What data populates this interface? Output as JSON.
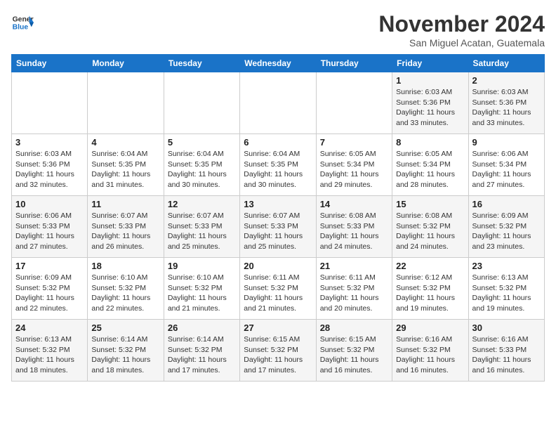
{
  "header": {
    "logo_line1": "General",
    "logo_line2": "Blue",
    "month": "November 2024",
    "location": "San Miguel Acatan, Guatemala"
  },
  "weekdays": [
    "Sunday",
    "Monday",
    "Tuesday",
    "Wednesday",
    "Thursday",
    "Friday",
    "Saturday"
  ],
  "weeks": [
    [
      {
        "day": "",
        "info": ""
      },
      {
        "day": "",
        "info": ""
      },
      {
        "day": "",
        "info": ""
      },
      {
        "day": "",
        "info": ""
      },
      {
        "day": "",
        "info": ""
      },
      {
        "day": "1",
        "info": "Sunrise: 6:03 AM\nSunset: 5:36 PM\nDaylight: 11 hours and 33 minutes."
      },
      {
        "day": "2",
        "info": "Sunrise: 6:03 AM\nSunset: 5:36 PM\nDaylight: 11 hours and 33 minutes."
      }
    ],
    [
      {
        "day": "3",
        "info": "Sunrise: 6:03 AM\nSunset: 5:36 PM\nDaylight: 11 hours and 32 minutes."
      },
      {
        "day": "4",
        "info": "Sunrise: 6:04 AM\nSunset: 5:35 PM\nDaylight: 11 hours and 31 minutes."
      },
      {
        "day": "5",
        "info": "Sunrise: 6:04 AM\nSunset: 5:35 PM\nDaylight: 11 hours and 30 minutes."
      },
      {
        "day": "6",
        "info": "Sunrise: 6:04 AM\nSunset: 5:35 PM\nDaylight: 11 hours and 30 minutes."
      },
      {
        "day": "7",
        "info": "Sunrise: 6:05 AM\nSunset: 5:34 PM\nDaylight: 11 hours and 29 minutes."
      },
      {
        "day": "8",
        "info": "Sunrise: 6:05 AM\nSunset: 5:34 PM\nDaylight: 11 hours and 28 minutes."
      },
      {
        "day": "9",
        "info": "Sunrise: 6:06 AM\nSunset: 5:34 PM\nDaylight: 11 hours and 27 minutes."
      }
    ],
    [
      {
        "day": "10",
        "info": "Sunrise: 6:06 AM\nSunset: 5:33 PM\nDaylight: 11 hours and 27 minutes."
      },
      {
        "day": "11",
        "info": "Sunrise: 6:07 AM\nSunset: 5:33 PM\nDaylight: 11 hours and 26 minutes."
      },
      {
        "day": "12",
        "info": "Sunrise: 6:07 AM\nSunset: 5:33 PM\nDaylight: 11 hours and 25 minutes."
      },
      {
        "day": "13",
        "info": "Sunrise: 6:07 AM\nSunset: 5:33 PM\nDaylight: 11 hours and 25 minutes."
      },
      {
        "day": "14",
        "info": "Sunrise: 6:08 AM\nSunset: 5:33 PM\nDaylight: 11 hours and 24 minutes."
      },
      {
        "day": "15",
        "info": "Sunrise: 6:08 AM\nSunset: 5:32 PM\nDaylight: 11 hours and 24 minutes."
      },
      {
        "day": "16",
        "info": "Sunrise: 6:09 AM\nSunset: 5:32 PM\nDaylight: 11 hours and 23 minutes."
      }
    ],
    [
      {
        "day": "17",
        "info": "Sunrise: 6:09 AM\nSunset: 5:32 PM\nDaylight: 11 hours and 22 minutes."
      },
      {
        "day": "18",
        "info": "Sunrise: 6:10 AM\nSunset: 5:32 PM\nDaylight: 11 hours and 22 minutes."
      },
      {
        "day": "19",
        "info": "Sunrise: 6:10 AM\nSunset: 5:32 PM\nDaylight: 11 hours and 21 minutes."
      },
      {
        "day": "20",
        "info": "Sunrise: 6:11 AM\nSunset: 5:32 PM\nDaylight: 11 hours and 21 minutes."
      },
      {
        "day": "21",
        "info": "Sunrise: 6:11 AM\nSunset: 5:32 PM\nDaylight: 11 hours and 20 minutes."
      },
      {
        "day": "22",
        "info": "Sunrise: 6:12 AM\nSunset: 5:32 PM\nDaylight: 11 hours and 19 minutes."
      },
      {
        "day": "23",
        "info": "Sunrise: 6:13 AM\nSunset: 5:32 PM\nDaylight: 11 hours and 19 minutes."
      }
    ],
    [
      {
        "day": "24",
        "info": "Sunrise: 6:13 AM\nSunset: 5:32 PM\nDaylight: 11 hours and 18 minutes."
      },
      {
        "day": "25",
        "info": "Sunrise: 6:14 AM\nSunset: 5:32 PM\nDaylight: 11 hours and 18 minutes."
      },
      {
        "day": "26",
        "info": "Sunrise: 6:14 AM\nSunset: 5:32 PM\nDaylight: 11 hours and 17 minutes."
      },
      {
        "day": "27",
        "info": "Sunrise: 6:15 AM\nSunset: 5:32 PM\nDaylight: 11 hours and 17 minutes."
      },
      {
        "day": "28",
        "info": "Sunrise: 6:15 AM\nSunset: 5:32 PM\nDaylight: 11 hours and 16 minutes."
      },
      {
        "day": "29",
        "info": "Sunrise: 6:16 AM\nSunset: 5:32 PM\nDaylight: 11 hours and 16 minutes."
      },
      {
        "day": "30",
        "info": "Sunrise: 6:16 AM\nSunset: 5:33 PM\nDaylight: 11 hours and 16 minutes."
      }
    ]
  ]
}
